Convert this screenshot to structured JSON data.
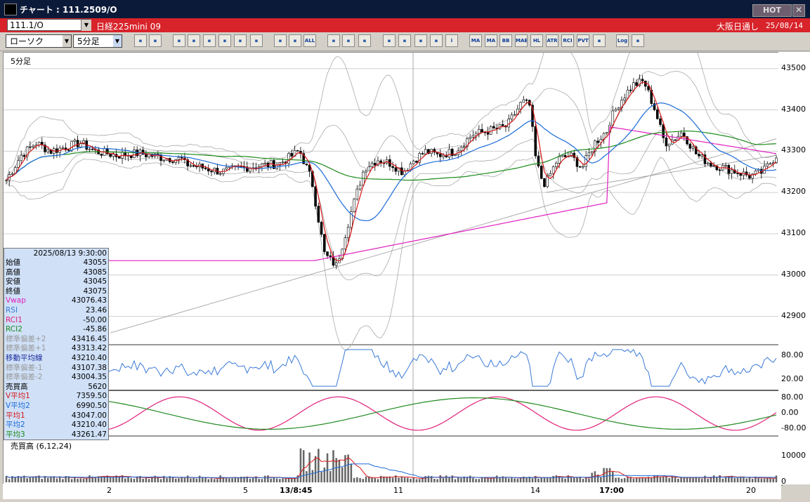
{
  "window": {
    "title": "チャート : 111.2509/O",
    "hot_label": "HOT",
    "close_label": "✕"
  },
  "infobar": {
    "symbol": "111.1/O",
    "instrument": "日経225mini 09",
    "market": "大阪日通し",
    "date": "25/08/14"
  },
  "toolbar": {
    "chart_type": "ローソク",
    "interval": "5分足",
    "buttons": [
      {
        "name": "zoom-icon",
        "label": ""
      },
      {
        "name": "window-icon",
        "label": ""
      },
      {
        "name": "pen-icon",
        "label": ""
      },
      {
        "name": "line-draw-icon",
        "label": ""
      },
      {
        "name": "cursor-icon",
        "label": ""
      },
      {
        "name": "undo-icon",
        "label": ""
      },
      {
        "name": "list-icon",
        "label": ""
      },
      {
        "name": "trash-icon",
        "label": ""
      },
      {
        "name": "candle-left-icon",
        "label": ""
      },
      {
        "name": "candle-right-icon",
        "label": ""
      },
      {
        "name": "all-icon",
        "label": "ALL"
      },
      {
        "name": "settings-icon",
        "label": ""
      },
      {
        "name": "brush-icon",
        "label": ""
      },
      {
        "name": "color-icon",
        "label": ""
      },
      {
        "name": "down-arrow-icon",
        "label": ""
      },
      {
        "name": "search-chart-icon",
        "label": ""
      },
      {
        "name": "chart-icon",
        "label": ""
      },
      {
        "name": "clear-icon",
        "label": ""
      },
      {
        "name": "info-icon",
        "label": "i"
      },
      {
        "name": "ma-icon",
        "label": "MA"
      },
      {
        "name": "vma-icon",
        "label": "MA"
      },
      {
        "name": "bb-icon",
        "label": "BB"
      },
      {
        "name": "mae-icon",
        "label": "MAE"
      },
      {
        "name": "hl-icon",
        "label": "HL"
      },
      {
        "name": "atr-icon",
        "label": "ATR"
      },
      {
        "name": "rci-icon",
        "label": "RCI"
      },
      {
        "name": "pvt-icon",
        "label": "PVT"
      },
      {
        "name": "frame-icon",
        "label": ""
      },
      {
        "name": "log-icon",
        "label": "Log"
      },
      {
        "name": "export-icon",
        "label": ""
      }
    ]
  },
  "chart": {
    "period_label": "5分足",
    "volume_label": "売買高 (6,12,24)",
    "price_ticks": [
      "43500",
      "43400",
      "43300",
      "43200",
      "43100",
      "43000",
      "42900"
    ],
    "rsi_ticks": [
      "80.00",
      "20.00"
    ],
    "rci_ticks": [
      "80.00",
      "0.00",
      "-80.00"
    ],
    "vol_ticks": [
      "10000",
      "0"
    ],
    "x_ticks": [
      "2",
      "5",
      "13/8:45",
      "11",
      "14",
      "17:00",
      "20"
    ],
    "colors": {
      "up": "#ffffff",
      "down": "#000000",
      "vwap": "#e020c0",
      "ma1": "#d81818",
      "ma2": "#1a6ad8",
      "ma3": "#1a8a1a",
      "bb": "#aaaaaa",
      "trend": "#999999",
      "rsi": "#3a7ad8",
      "rci1": "#e0207a",
      "rci2": "#208a20"
    }
  },
  "chart_data": {
    "type": "candlestick",
    "interval": "5分足",
    "x_ticks": [
      "2",
      "5",
      "13/8:45",
      "11",
      "14",
      "17:00",
      "20"
    ],
    "y_ticks": [
      43500,
      43400,
      43300,
      43200,
      43100,
      43000,
      42900
    ],
    "ylim": [
      42850,
      43525
    ],
    "segments": [
      {
        "from": 0,
        "to": 0.115,
        "start": 43230,
        "path": [
          43290,
          43320,
          43300,
          43310,
          43320,
          43300
        ]
      },
      {
        "from": 0.115,
        "to": 0.23,
        "start": 43300,
        "path": [
          43290,
          43295,
          43285,
          43280
        ]
      },
      {
        "from": 0.23,
        "to": 0.38,
        "start": 43270,
        "path": [
          43260,
          43250,
          43260,
          43265,
          43270,
          43300
        ]
      },
      {
        "from": 0.38,
        "to": 0.43,
        "start": 43305,
        "path": [
          43230,
          43050,
          43020
        ]
      },
      {
        "from": 0.43,
        "to": 0.5,
        "start": 43030,
        "path": [
          43150,
          43260,
          43280,
          43270
        ]
      },
      {
        "from": 0.5,
        "to": 0.56,
        "start": 43270,
        "path": [
          43250,
          43280,
          43300,
          43290
        ]
      },
      {
        "from": 0.56,
        "to": 0.65,
        "start": 43290,
        "path": [
          43300,
          43340,
          43350,
          43360
        ]
      },
      {
        "from": 0.65,
        "to": 0.68,
        "start": 43360,
        "path": [
          43390,
          43420,
          43410
        ]
      },
      {
        "from": 0.68,
        "to": 0.7,
        "start": 43410,
        "path": [
          43290,
          43240,
          43220
        ]
      },
      {
        "from": 0.7,
        "to": 0.78,
        "start": 43220,
        "path": [
          43280,
          43290,
          43260,
          43320,
          43350
        ]
      },
      {
        "from": 0.78,
        "to": 0.83,
        "start": 43360,
        "path": [
          43420,
          43460,
          43470
        ]
      },
      {
        "from": 0.83,
        "to": 0.88,
        "start": 43460,
        "path": [
          43400,
          43320,
          43330,
          43350
        ]
      },
      {
        "from": 0.88,
        "to": 1.0,
        "start": 43340,
        "path": [
          43290,
          43270,
          43260,
          43250,
          43240,
          43250,
          43290
        ]
      }
    ]
  },
  "panel": {
    "datetime": "2025/08/13 9:30:00",
    "rows": [
      {
        "key": "始値",
        "value": "43055",
        "color": "#000000"
      },
      {
        "key": "高値",
        "value": "43085",
        "color": "#000000"
      },
      {
        "key": "安値",
        "value": "43045",
        "color": "#000000"
      },
      {
        "key": "終値",
        "value": "43075",
        "color": "#000000"
      },
      {
        "key": "Vwap",
        "value": "43076.43",
        "color": "#e020c0"
      },
      {
        "key": "RSI",
        "value": "23.46",
        "color": "#3a7ad8"
      },
      {
        "key": "RCI1",
        "value": "-50.00",
        "color": "#e0207a"
      },
      {
        "key": "RCI2",
        "value": "-45.86",
        "color": "#208a20"
      },
      {
        "key": "標準偏差+2",
        "value": "43416.45",
        "color": "#999999"
      },
      {
        "key": "標準偏差+1",
        "value": "43313.42",
        "color": "#999999"
      },
      {
        "key": "移動平均線",
        "value": "43210.40",
        "color": "#1a2a9a"
      },
      {
        "key": "標準偏差-1",
        "value": "43107.38",
        "color": "#999999"
      },
      {
        "key": "標準偏差-2",
        "value": "43004.35",
        "color": "#999999"
      },
      {
        "key": "売買高",
        "value": "5620",
        "color": "#000000"
      },
      {
        "key": "V平均1",
        "value": "7359.50",
        "color": "#d81818"
      },
      {
        "key": "V平均2",
        "value": "6990.50",
        "color": "#1a6ad8"
      },
      {
        "key": "平均1",
        "value": "43047.00",
        "color": "#d81818"
      },
      {
        "key": "平均2",
        "value": "43210.40",
        "color": "#1a6ad8"
      },
      {
        "key": "平均3",
        "value": "43261.47",
        "color": "#1a8a1a"
      }
    ]
  }
}
